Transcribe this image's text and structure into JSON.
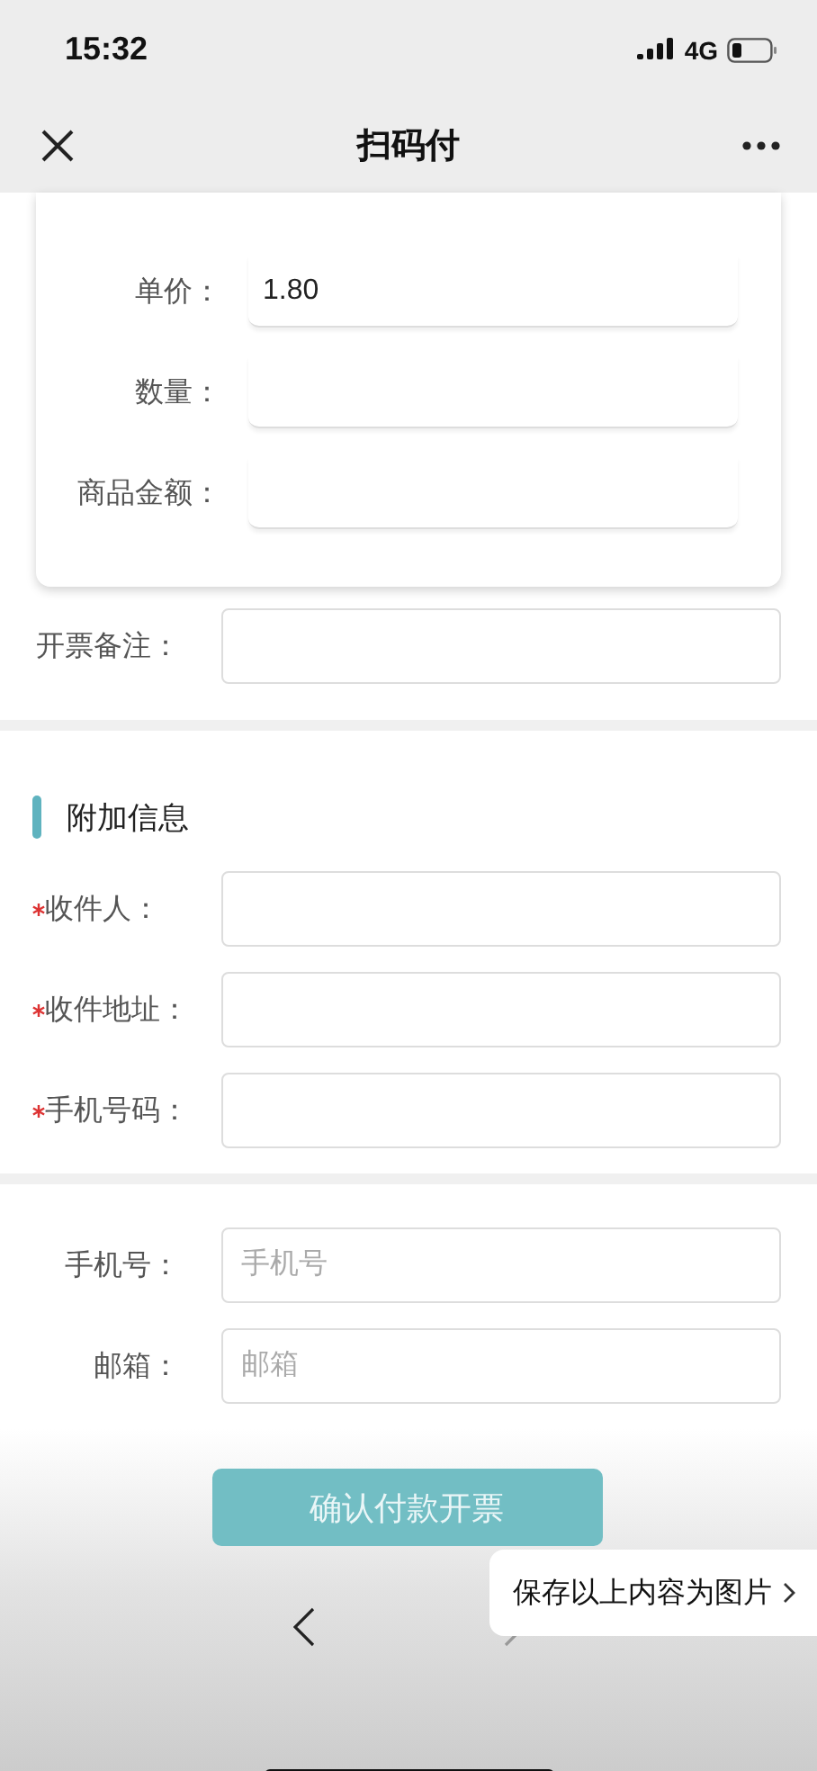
{
  "status_bar": {
    "time": "15:32",
    "network": "4G"
  },
  "nav": {
    "title": "扫码付"
  },
  "product_card": {
    "rows": [
      {
        "label": "单价：",
        "value": "1.80"
      },
      {
        "label": "数量："
      },
      {
        "label": "商品金额："
      }
    ]
  },
  "remark": {
    "label": "开票备注："
  },
  "additional": {
    "title": "附加信息",
    "fields": [
      {
        "label": "收件人：",
        "required": true
      },
      {
        "label": "收件地址：",
        "required": true
      },
      {
        "label": "手机号码：",
        "required": true
      }
    ]
  },
  "contact": {
    "fields": [
      {
        "label": "手机号：",
        "placeholder": "手机号"
      },
      {
        "label": "邮箱：",
        "placeholder": "邮箱"
      }
    ]
  },
  "submit_button": "确认付款开票",
  "save_popup": "保存以上内容为图片"
}
